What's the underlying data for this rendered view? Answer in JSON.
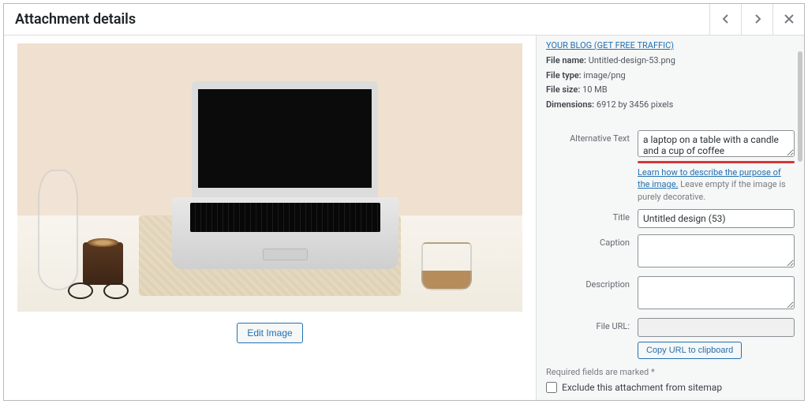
{
  "header": {
    "title": "Attachment details"
  },
  "image": {
    "edit_button": "Edit Image"
  },
  "sidebar": {
    "top_link": "YOUR BLOG (GET FREE TRAFFIC)",
    "meta": {
      "file_name_label": "File name:",
      "file_name_value": "Untitled-design-53.png",
      "file_type_label": "File type:",
      "file_type_value": "image/png",
      "file_size_label": "File size:",
      "file_size_value": "10 MB",
      "dimensions_label": "Dimensions:",
      "dimensions_value": "6912 by 3456 pixels"
    },
    "fields": {
      "alt_label": "Alternative Text",
      "alt_value": "a laptop on a table with a candle and a cup of coffee",
      "alt_learn_link": "Learn how to describe the purpose of the image.",
      "alt_note_tail": " Leave empty if the image is purely decorative.",
      "title_label": "Title",
      "title_value": "Untitled design (53)",
      "caption_label": "Caption",
      "caption_value": "",
      "description_label": "Description",
      "description_value": "",
      "file_url_label": "File URL:",
      "file_url_value": "",
      "copy_button": "Copy URL to clipboard"
    },
    "required_note": "Required fields are marked *",
    "exclude_label": "Exclude this attachment from sitemap"
  }
}
